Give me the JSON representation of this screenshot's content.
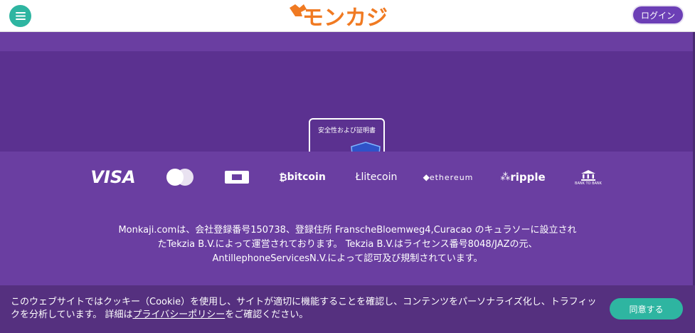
{
  "header": {
    "logo_text": "モンカジ",
    "login_label": "ログイン",
    "menu_icon": "hamburger-icon"
  },
  "security_badge": {
    "label": "安全性および証明書",
    "icon": "xcm-shield-icon"
  },
  "payments": {
    "items": [
      {
        "label": "VISA",
        "icon": "visa-icon"
      },
      {
        "label": "",
        "icon": "mastercard-icon"
      },
      {
        "label": "",
        "icon": "card-icon"
      },
      {
        "label": "bitcoin",
        "icon": "bitcoin-icon"
      },
      {
        "label": "litecoin",
        "icon": "litecoin-icon"
      },
      {
        "label": "ethereum",
        "icon": "ethereum-icon"
      },
      {
        "label": "ripple",
        "icon": "ripple-icon"
      },
      {
        "label": "BANK TO BANK",
        "icon": "bank-icon"
      }
    ]
  },
  "legal": {
    "line1": "Monkaji.comは、会社登録番号150738、登録住所 FranscheBloemweg4,Curacao のキュラソーに設立され",
    "line2": "たTekzia B.V.によって運営されております。 Tekzia B.V.はライセンス番号8048/JAZの元、",
    "line3": "AntillephoneServicesN.V.によって認可及び規制されています。"
  },
  "cookie": {
    "text_before": "このウェブサイトではクッキー（Cookie）を使用し、サイトが適切に機能することを確認し、コンテンツをパーソナライズ化し、トラフィックを分析しています。 詳細は",
    "link_text": "プライバシーポリシー",
    "text_after": "をご確認ください。",
    "agree_label": "同意する"
  },
  "colors": {
    "primary_purple": "#6a3ea1",
    "dark_purple": "#5b3190",
    "teal": "#2eb5a1",
    "logo_orange": "#f07a22"
  }
}
